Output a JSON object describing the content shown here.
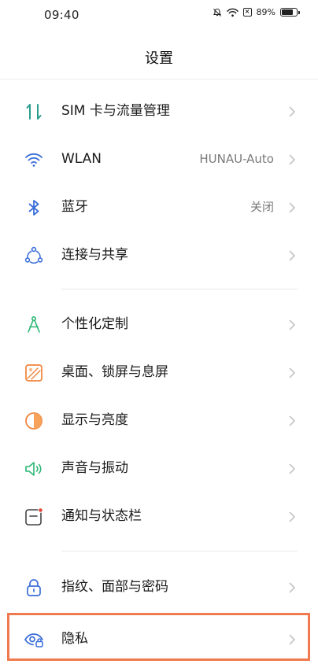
{
  "status": {
    "time": "09:40",
    "battery": "89%",
    "battery_level": 0.89
  },
  "header": {
    "title": "设置"
  },
  "groups": [
    {
      "items": [
        {
          "label": "SIM 卡与流量管理",
          "value": ""
        },
        {
          "label": "WLAN",
          "value": "HUNAU-Auto"
        },
        {
          "label": "蓝牙",
          "value": "关闭"
        },
        {
          "label": "连接与共享",
          "value": ""
        }
      ]
    },
    {
      "items": [
        {
          "label": "个性化定制",
          "value": ""
        },
        {
          "label": "桌面、锁屏与息屏",
          "value": ""
        },
        {
          "label": "显示与亮度",
          "value": ""
        },
        {
          "label": "声音与振动",
          "value": ""
        },
        {
          "label": "通知与状态栏",
          "value": ""
        }
      ]
    },
    {
      "items": [
        {
          "label": "指纹、面部与密码",
          "value": ""
        },
        {
          "label": "隐私",
          "value": ""
        }
      ]
    }
  ],
  "colors": {
    "sim": "#2a9d8f",
    "wlan": "#3b6fd8",
    "bluetooth": "#3b6fd8",
    "share": "#3b6fd8",
    "theme": "#2bb673",
    "wallpaper": "#f0843c",
    "display": "#f0843c",
    "sound": "#2bb673",
    "notify": "#e0463a",
    "security": "#3b6fd8",
    "privacy": "#3b6fd8",
    "highlight": "#f07a4f"
  },
  "icons": [
    "sim-data-icon",
    "wifi-icon",
    "bluetooth-icon",
    "share-icon",
    "theme-compass-icon",
    "wallpaper-icon",
    "display-brightness-icon",
    "speaker-icon",
    "notification-icon",
    "lock-icon",
    "privacy-eye-icon"
  ]
}
